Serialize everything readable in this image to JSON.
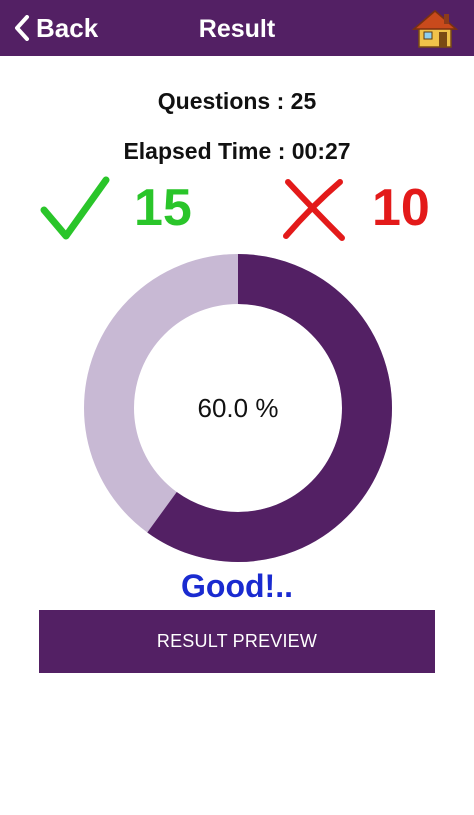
{
  "header": {
    "back_label": "Back",
    "title": "Result",
    "home_icon": "home-icon"
  },
  "summary": {
    "questions_text": "Questions : 25",
    "elapsed_text": "Elapsed Time : 00:27",
    "correct_count": "15",
    "wrong_count": "10"
  },
  "progress": {
    "percent_text": "60.0 %",
    "fraction": 0.6,
    "filled_color": "#532064",
    "remaining_color": "#c8b9d4"
  },
  "verdict": "Good!..",
  "actions": {
    "preview_label": "RESULT PREVIEW"
  },
  "colors": {
    "primary": "#532064",
    "correct": "#2ac52a",
    "wrong": "#e31a1a",
    "verdict": "#1a2bd0"
  }
}
